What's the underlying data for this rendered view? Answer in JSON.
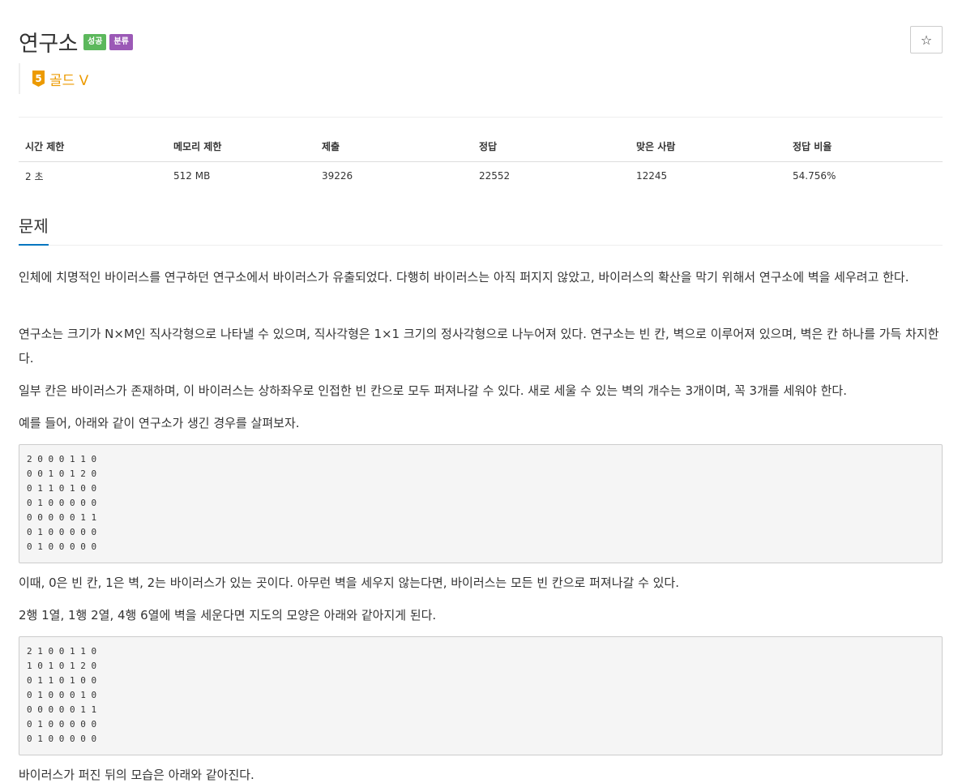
{
  "problem": {
    "title": "연구소",
    "labels": {
      "success": "성공",
      "category": "분류"
    },
    "star_icon": "☆",
    "tier": {
      "number": "5",
      "name": "골드 V",
      "color": "#ec9a00"
    }
  },
  "info_table": {
    "headers": [
      "시간 제한",
      "메모리 제한",
      "제출",
      "정답",
      "맞은 사람",
      "정답 비율"
    ],
    "values": [
      "2 초",
      "512 MB",
      "39226",
      "22552",
      "12245",
      "54.756%"
    ]
  },
  "section": {
    "title": "문제"
  },
  "description": {
    "p1": "인체에 치명적인 바이러스를 연구하던 연구소에서 바이러스가 유출되었다. 다행히 바이러스는 아직 퍼지지 않았고, 바이러스의 확산을 막기 위해서 연구소에 벽을 세우려고 한다.",
    "p2": "연구소는 크기가 N×M인 직사각형으로 나타낼 수 있으며, 직사각형은 1×1 크기의 정사각형으로 나누어져 있다. 연구소는 빈 칸, 벽으로 이루어져 있으며, 벽은 칸 하나를 가득 차지한다.",
    "p3": "일부 칸은 바이러스가 존재하며, 이 바이러스는 상하좌우로 인접한 빈 칸으로 모두 퍼져나갈 수 있다. 새로 세울 수 있는 벽의 개수는 3개이며, 꼭 3개를 세워야 한다.",
    "p4": "예를 들어, 아래와 같이 연구소가 생긴 경우를 살펴보자.",
    "grid1": "2 0 0 0 1 1 0\n0 0 1 0 1 2 0\n0 1 1 0 1 0 0\n0 1 0 0 0 0 0\n0 0 0 0 0 1 1\n0 1 0 0 0 0 0\n0 1 0 0 0 0 0",
    "p5": "이때, 0은 빈 칸, 1은 벽, 2는 바이러스가 있는 곳이다. 아무런 벽을 세우지 않는다면, 바이러스는 모든 빈 칸으로 퍼져나갈 수 있다.",
    "p6": "2행 1열, 1행 2열, 4행 6열에 벽을 세운다면 지도의 모양은 아래와 같아지게 된다.",
    "grid2": "2 1 0 0 1 1 0\n1 0 1 0 1 2 0\n0 1 1 0 1 0 0\n0 1 0 0 0 1 0\n0 0 0 0 0 1 1\n0 1 0 0 0 0 0\n0 1 0 0 0 0 0",
    "p7": "바이러스가 퍼진 뒤의 모습은 아래와 같아진다."
  }
}
